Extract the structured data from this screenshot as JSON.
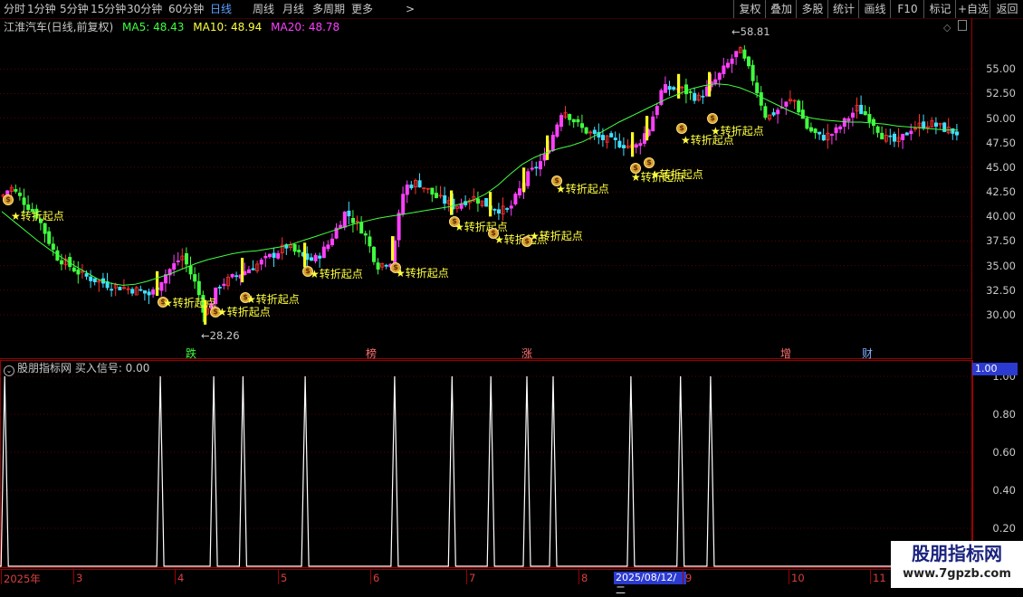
{
  "toolbar": {
    "tabs": [
      "分时",
      "1分钟",
      "5分钟",
      "15分钟",
      "30分钟",
      "60分钟",
      "日线",
      "周线",
      "月线",
      "多周期",
      "更多"
    ],
    "active_tab": "日线",
    "more_arrow": ">",
    "right_buttons": [
      "复权",
      "叠加",
      "多股",
      "统计",
      "画线",
      "F10",
      "标记",
      "+自选",
      "返回"
    ]
  },
  "info": {
    "title": "江淮汽车(日线,前复权)",
    "ma5": "MA5: 48.43",
    "ma10": "MA10: 48.94",
    "ma20": "MA20: 48.78",
    "ma5_color": "#ffffff",
    "ma10_color": "#ffff40",
    "ma20_color": "#ff40ff"
  },
  "price_axis": [
    "55.00",
    "52.50",
    "50.00",
    "47.50",
    "45.00",
    "42.50",
    "40.00",
    "37.50",
    "35.00",
    "32.50",
    "30.00"
  ],
  "high_label": "58.81",
  "low_label": "28.26",
  "signal_text": "转折起点",
  "star": "★",
  "bag_symbol": "$",
  "events": [
    {
      "text": "跌",
      "color": "#40ff40"
    },
    {
      "text": "榜",
      "color": "#ff7070"
    },
    {
      "text": "涨",
      "color": "#ff7070"
    },
    {
      "text": "增",
      "color": "#ff7070"
    },
    {
      "text": "财",
      "color": "#7fb0ff"
    }
  ],
  "indicator": {
    "title": "股朋指标网 买入信号: 0.00",
    "axis": [
      "1.00",
      "0.80",
      "0.60",
      "0.40",
      "0.20"
    ],
    "current_value": "1.00"
  },
  "time_axis": [
    "2025年",
    "3",
    "4",
    "5",
    "6",
    "7",
    "8",
    "2025/08/12/二",
    "9",
    "10",
    "11"
  ],
  "watermark": {
    "line1": "股朋指标网",
    "line2": "www.7gpzb.com"
  },
  "chart_data": {
    "type": "candlestick",
    "title": "江淮汽车(日线,前复权)",
    "price_range": [
      26,
      60
    ],
    "high": 58.81,
    "low": 28.26,
    "signal_price": [
      40.8,
      31.8,
      30.8,
      32.5,
      35.0,
      34.8,
      39.3,
      38.8,
      38.0,
      38.3,
      43.5,
      44.0,
      44.2,
      48.5,
      49.5
    ],
    "ma20": [
      40.5,
      39.5,
      38.5,
      37.5,
      36.6,
      35.8,
      35.0,
      34.3,
      33.6,
      33.2,
      33.0,
      33.1,
      33.4,
      33.8,
      34.2,
      34.7,
      35.2,
      35.6,
      35.9,
      36.2,
      36.4,
      36.5,
      36.7,
      36.9,
      37.2,
      37.6,
      38.0,
      38.4,
      38.8,
      39.2,
      39.5,
      39.8,
      40.0,
      40.2,
      40.4,
      40.6,
      40.8,
      41.0,
      41.3,
      41.7,
      42.3,
      43.2,
      44.3,
      45.3,
      46.0,
      46.5,
      46.9,
      47.2,
      47.6,
      48.2,
      48.9,
      49.6,
      50.2,
      50.8,
      51.4,
      52.0,
      52.5,
      53.0,
      53.3,
      53.5,
      53.4,
      53.1,
      52.6,
      52.0,
      51.4,
      50.8,
      50.3,
      50.0,
      49.8,
      49.7,
      49.6,
      49.6,
      49.5,
      49.4,
      49.2,
      49.1,
      49.0,
      48.9,
      48.8,
      48.8
    ],
    "buy_signal_x": [
      0.003,
      0.163,
      0.218,
      0.248,
      0.312,
      0.404,
      0.463,
      0.503,
      0.54,
      0.567,
      0.647,
      0.698,
      0.729
    ],
    "buy_signal_value": 1.0,
    "indicator_range": [
      0,
      1.05
    ]
  }
}
